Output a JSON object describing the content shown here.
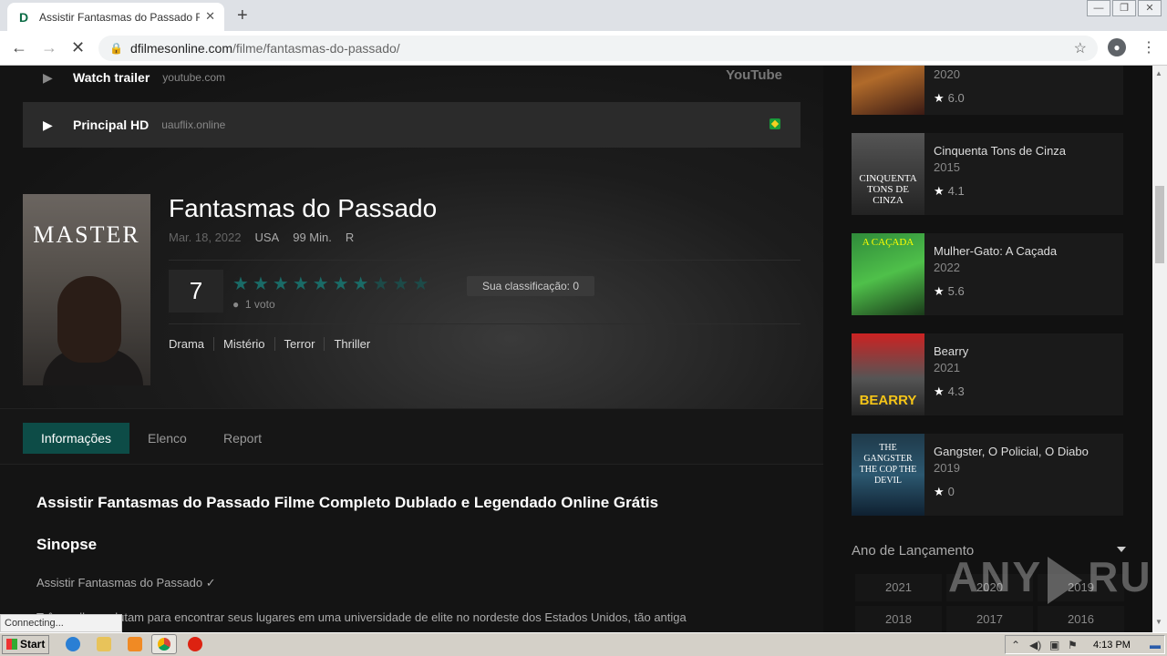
{
  "browser": {
    "tab_title": "Assistir Fantasmas do Passado Filme",
    "url_host": "dfilmesonline.com",
    "url_path": "/filme/fantasmas-do-passado/",
    "status": "Connecting..."
  },
  "players": [
    {
      "name": "Watch trailer",
      "host": "youtube.com",
      "badge": "YouTube"
    },
    {
      "name": "Principal HD",
      "host": "uauflix.online"
    }
  ],
  "movie": {
    "poster_title": "MASTER",
    "title": "Fantasmas do Passado",
    "date": "Mar. 18, 2022",
    "country": "USA",
    "runtime": "99 Min.",
    "rating_code": "R",
    "score": "7",
    "stars_filled": 7,
    "stars_total": 10,
    "rate_label": "Sua classificação: 0",
    "votes": "1 voto",
    "genres": [
      "Drama",
      "Mistério",
      "Terror",
      "Thriller"
    ]
  },
  "tabs": [
    "Informações",
    "Elenco",
    "Report"
  ],
  "content": {
    "heading": "Assistir Fantasmas do Passado Filme Completo Dublado e Legendado Online Grátis",
    "synopsis_heading": "Sinopse",
    "line1": "Assistir Fantasmas do Passado ✓",
    "line2": "Três mulheres lutam para encontrar seus lugares em uma universidade de elite no nordeste dos Estados Unidos, tão antiga"
  },
  "sidebar": {
    "partial_item": {
      "year": "2020",
      "rating": "6.0"
    },
    "items": [
      {
        "name": "Cinquenta Tons de Cinza",
        "year": "2015",
        "rating": "4.1",
        "poster_text": "CINQUENTA TONS DE CINZA"
      },
      {
        "name": "Mulher-Gato: A Caçada",
        "year": "2022",
        "rating": "5.6",
        "poster_text": "A CAÇADA"
      },
      {
        "name": "Bearry",
        "year": "2021",
        "rating": "4.3",
        "poster_text": "BEARRY"
      },
      {
        "name": "Gangster, O Policial, O Diabo",
        "year": "2019",
        "rating": "0",
        "poster_text": "THE GANGSTER THE COP THE DEVIL"
      }
    ],
    "year_heading": "Ano de Lançamento",
    "years": [
      "2021",
      "2020",
      "2019",
      "2018",
      "2017",
      "2016"
    ]
  },
  "watermark": {
    "left": "ANY",
    "right": "RUN"
  },
  "taskbar": {
    "start": "Start",
    "clock": "4:13 PM"
  }
}
